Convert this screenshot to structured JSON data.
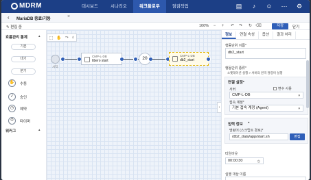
{
  "app": {
    "logo": "MDRM",
    "menu": [
      "대시보드",
      "시나리오",
      "워크플로우",
      "점검작업"
    ],
    "active_menu_index": 2
  },
  "subheader": {
    "workflow_name": "MariaDB 종료/기동"
  },
  "toolbar": {
    "edit_label": "✎ 편집 중",
    "zoom": "100%",
    "save_label": "저장",
    "close_label": "닫기"
  },
  "palette": {
    "section_flow": "흐름관리 통제",
    "basic": "기본",
    "wait": "대기",
    "branch": "분기",
    "items": [
      {
        "icon": "hand-icon",
        "label": "수동"
      },
      {
        "icon": "approve-icon",
        "label": "승인"
      },
      {
        "icon": "clock-icon",
        "label": "예약"
      },
      {
        "icon": "timer-icon",
        "label": "타이머"
      }
    ],
    "section_group": "워커그"
  },
  "canvas": {
    "start_label": "시작",
    "nodes": [
      {
        "type": "CMP-L-DB",
        "name": "tibero start"
      },
      {
        "value": "20"
      },
      {
        "type": "CMP-L-DB",
        "name": "db2_start"
      }
    ]
  },
  "panel": {
    "tabs": [
      "정보",
      "연결 속성",
      "옵션",
      "결과 처리"
    ],
    "node_name_label": "행동단위 이름*",
    "node_name_value": "db2_start",
    "node_type_label": "행동단위 종류*",
    "node_type_path": "소켓레이션 실행 > 서버의 원격 명령어 실행",
    "connection_title": "연결 설정*",
    "server_label": "서버",
    "server_checkbox": "변수 사용",
    "server_value": "CMP-L-DB",
    "access_label": "접속 계정*",
    "access_value": "기본 접속 계정 (Agent)",
    "input_title": "입력 정보",
    "command_label": "명령어 (스크립트 경로)*",
    "command_value": "/db2_data/app/start.sh",
    "edit_button": "편집",
    "timeout_label": "타임아웃",
    "timeout_value": "00:00:30",
    "exec_user_label": "실행 대상 이름"
  }
}
